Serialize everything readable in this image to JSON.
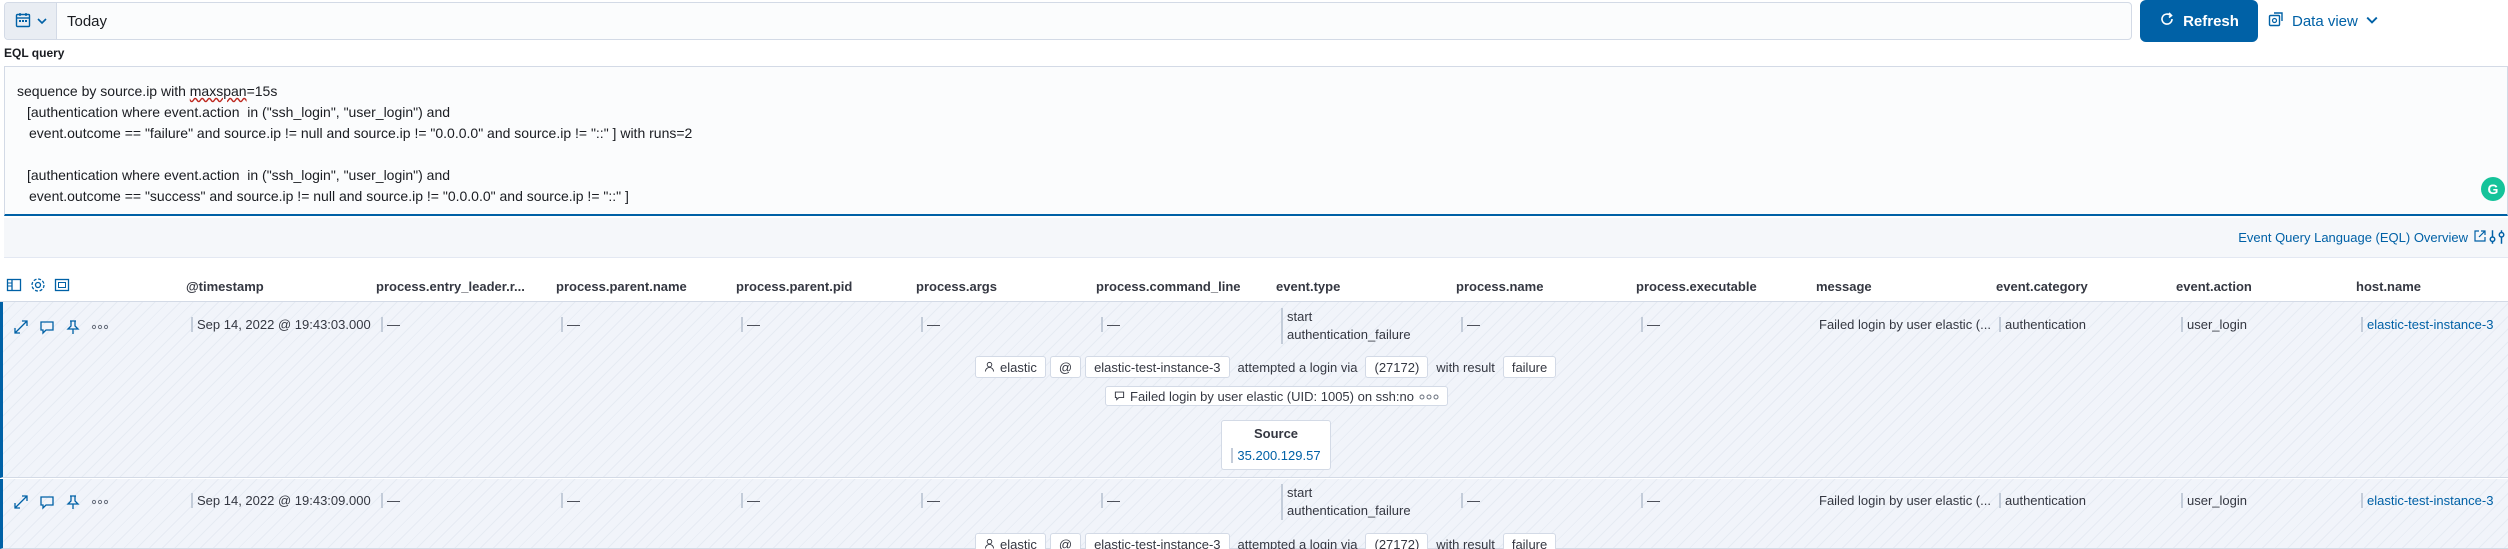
{
  "topbar": {
    "date_value": "Today",
    "refresh_label": "Refresh",
    "data_view_label": "Data view"
  },
  "eql": {
    "label": "EQL query",
    "lines": {
      "l1a": "sequence by source.ip with ",
      "l1b": "maxspan",
      "l1c": "=15s",
      "l2": "[authentication where event.action  in (\"ssh_login\", \"user_login\") and",
      "l3": "event.outcome == \"failure\" and source.ip != null and source.ip != \"0.0.0.0\" and source.ip != \"::\" ] with runs=2",
      "l4": "[authentication where event.action  in (\"ssh_login\", \"user_login\") and",
      "l5": "event.outcome == \"success\" and source.ip != null and source.ip != \"0.0.0.0\" and source.ip != \"::\" ]"
    },
    "overview_link": "Event Query Language (EQL) Overview"
  },
  "table": {
    "columns": [
      "@timestamp",
      "process.entry_leader.r...",
      "process.parent.name",
      "process.parent.pid",
      "process.args",
      "process.command_line",
      "event.type",
      "process.name",
      "process.executable",
      "message",
      "event.category",
      "event.action",
      "host.name"
    ],
    "rows": [
      {
        "timestamp": "Sep 14, 2022 @ 19:43:03.000",
        "dash": "—",
        "event_type_1": "start",
        "event_type_2": "authentication_failure",
        "message": "Failed login by user elastic (...",
        "category": "authentication",
        "action": "user_login",
        "host": "elastic-test-instance-3",
        "renderer": {
          "user": "elastic",
          "at": "@",
          "host": "elastic-test-instance-3",
          "attempted": "attempted a login via",
          "pid": "(27172)",
          "with_result": "with result",
          "result": "failure",
          "message": "Failed login by user elastic (UID: 1005) on ssh:no",
          "source_label": "Source",
          "source_ip": "35.200.129.57"
        }
      },
      {
        "timestamp": "Sep 14, 2022 @ 19:43:09.000",
        "dash": "—",
        "event_type_1": "start",
        "event_type_2": "authentication_failure",
        "message": "Failed login by user elastic (...",
        "category": "authentication",
        "action": "user_login",
        "host": "elastic-test-instance-3",
        "renderer": {
          "user": "elastic",
          "at": "@",
          "host": "elastic-test-instance-3",
          "attempted": "attempted a login via",
          "pid": "(27172)",
          "with_result": "with result",
          "result": "failure"
        }
      }
    ]
  },
  "icons": {
    "calendar": "calendar-icon",
    "refresh": "refresh-icon",
    "data_view": "data-view-icon",
    "external": "external-link-icon",
    "expand": "expand-icon",
    "note": "note-icon",
    "pin": "pin-icon",
    "more": "more-icon"
  }
}
